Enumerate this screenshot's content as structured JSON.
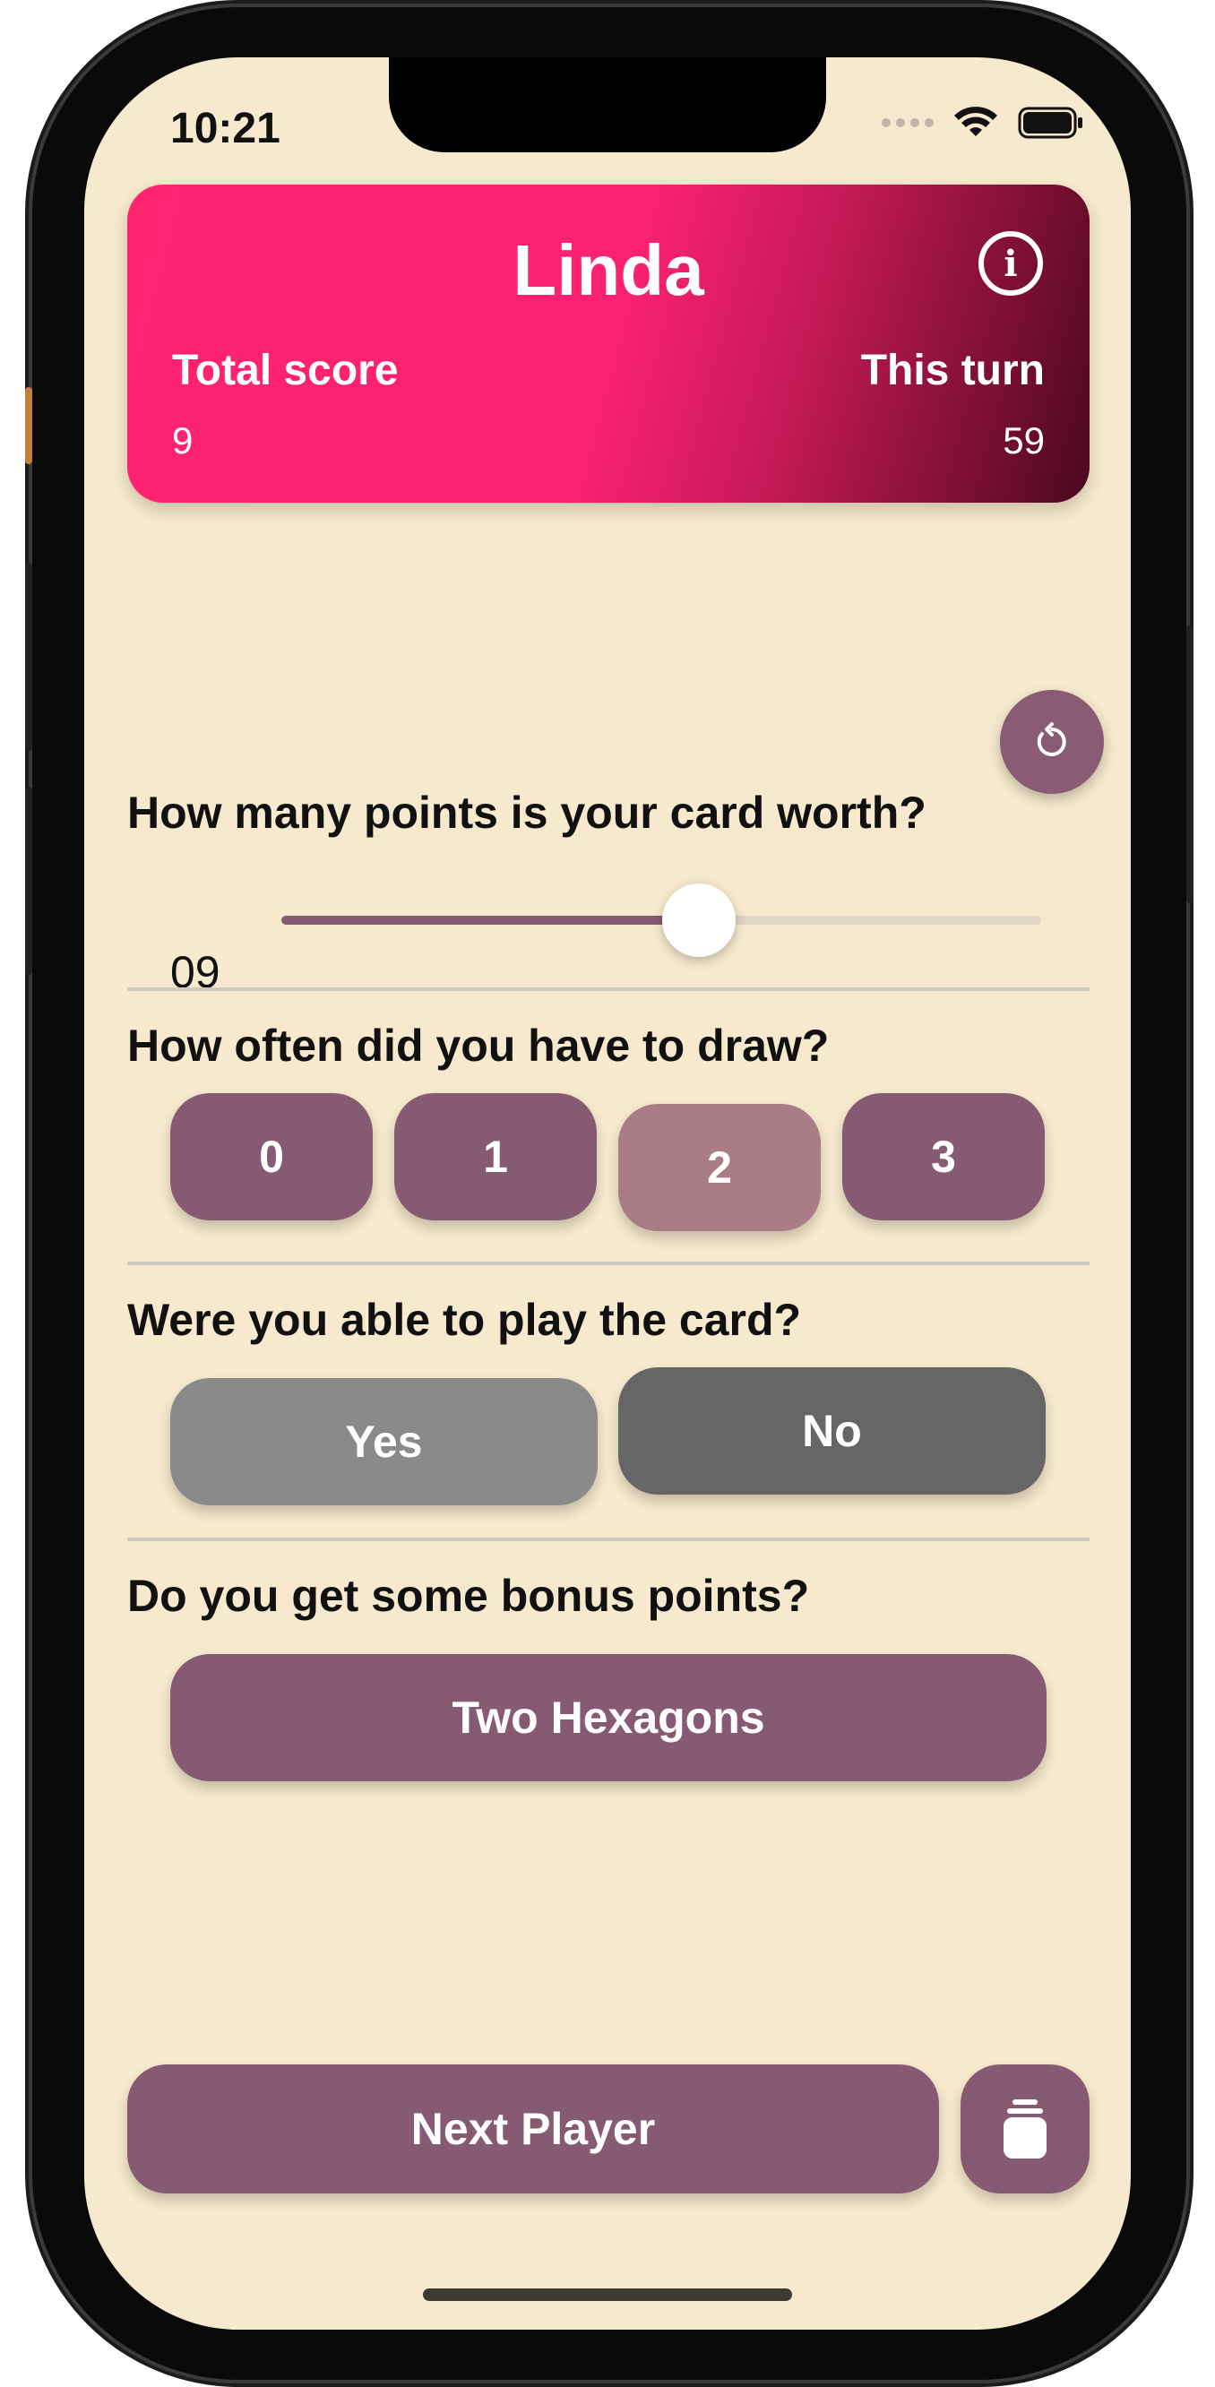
{
  "status_bar": {
    "time": "10:21"
  },
  "header": {
    "player_name": "Linda",
    "total_score_label": "Total score",
    "total_score_value": "9",
    "this_turn_label": "This turn",
    "this_turn_value": "59",
    "info_icon": "info-circle-icon"
  },
  "card_points": {
    "question": "How many points is your card worth?",
    "value": "09",
    "slider_fraction": 0.55
  },
  "draw": {
    "question": "How often did you have to draw?",
    "options": [
      "0",
      "1",
      "2",
      "3"
    ],
    "selected": "2"
  },
  "played": {
    "question": "Were you able to play the card?",
    "yes_label": "Yes",
    "no_label": "No"
  },
  "bonus": {
    "question": "Do you get some bonus points?",
    "button_label": "Two Hexagons"
  },
  "footer": {
    "next_label": "Next Player",
    "stack_icon": "card-stack-icon"
  },
  "colors": {
    "background": "#f6e9cd",
    "accent": "#875a73",
    "accent_selected": "#a97c86",
    "header_start": "#ff2370",
    "header_end": "#4a0820",
    "yes": "#8a8a8a",
    "no": "#666666"
  }
}
